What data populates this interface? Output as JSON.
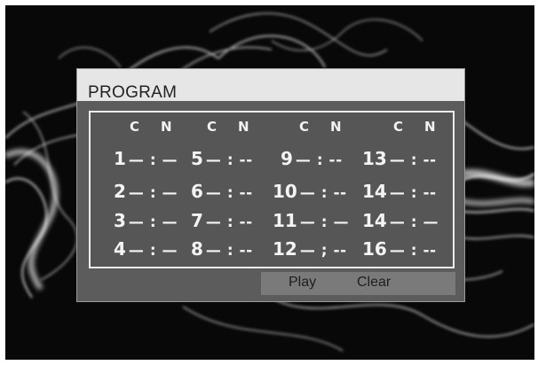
{
  "dialog": {
    "title": "PROGRAM",
    "column_headers": [
      "C",
      "N",
      "C",
      "N",
      "C",
      "N",
      "C",
      "N"
    ],
    "slots": [
      {
        "number": "1",
        "value": "— : —"
      },
      {
        "number": "2",
        "value": "— : —"
      },
      {
        "number": "3",
        "value": "— : —"
      },
      {
        "number": "4",
        "value": "— : —"
      },
      {
        "number": "5",
        "value": "— : --"
      },
      {
        "number": "6",
        "value": "— : --"
      },
      {
        "number": "7",
        "value": "— : --"
      },
      {
        "number": "8",
        "value": "— : --"
      },
      {
        "number": "9",
        "value": "— : --"
      },
      {
        "number": "10",
        "value": "— : --"
      },
      {
        "number": "11",
        "value": "— : —"
      },
      {
        "number": "12",
        "value": "— ; --"
      },
      {
        "number": "13",
        "value": "— : --"
      },
      {
        "number": "14",
        "value": "— : --"
      },
      {
        "number": "14",
        "value": "— : —"
      },
      {
        "number": "16",
        "value": "— : --"
      }
    ],
    "buttons": {
      "play": "Play",
      "clear": "Clear"
    }
  },
  "colors": {
    "screen_background": "#080808",
    "dialog_background": "#5c5c5c",
    "title_bar": "#e6e6e6",
    "grid_border": "#ececec",
    "button_strip": "#7a7a7a"
  }
}
